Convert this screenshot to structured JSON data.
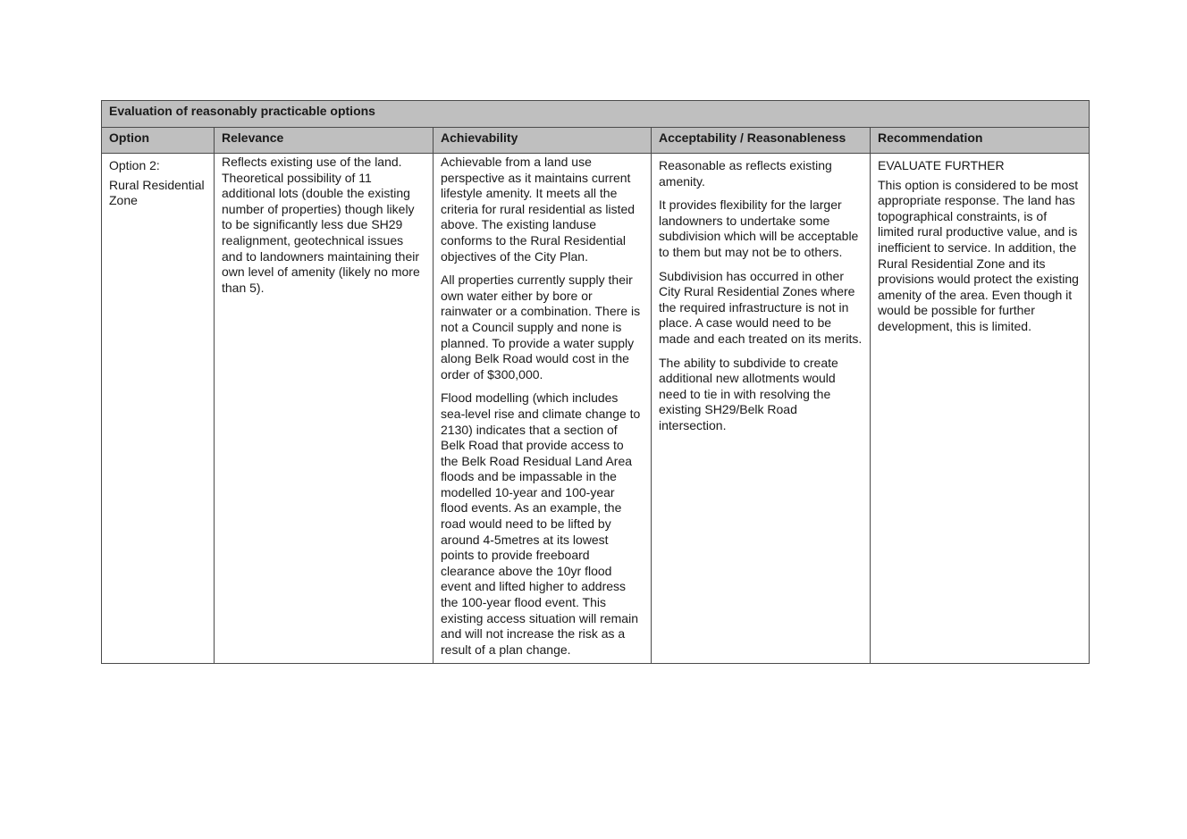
{
  "table": {
    "title": "Evaluation of reasonably practicable options",
    "headers": {
      "option": "Option",
      "relevance": "Relevance",
      "achievability": "Achievability",
      "acceptability": "Acceptability / Reasonableness",
      "recommendation": "Recommendation"
    },
    "row": {
      "option": [
        "Option 2:",
        "Rural Residential Zone"
      ],
      "relevance": [
        "Reflects existing use of the land. Theoretical possibility of 11 additional lots (double the existing number of properties) though likely to be significantly less due SH29 realignment, geotechnical issues and to landowners maintaining their own level of amenity (likely no more than 5)."
      ],
      "achievability": [
        "Achievable from a land use perspective as it maintains current lifestyle amenity. It meets all the criteria for rural residential as listed above. The existing landuse conforms to the Rural Residential objectives of the City Plan.",
        "All properties currently supply their own water either by bore or rainwater or a combination.  There is not a Council supply and none is planned. To provide a water supply along Belk Road would cost in the order of $300,000.",
        "Flood modelling (which includes sea-level rise and climate change to 2130) indicates that a section of Belk Road that provide access to the Belk Road Residual Land Area floods and be impassable in the modelled 10-year and 100-year flood events. As an example, the road would need to be lifted by around 4-5metres at its lowest points to provide freeboard clearance above the 10yr flood event and lifted higher to address the 100-year flood event. This existing access situation will remain and will not increase the risk as a result of a plan change."
      ],
      "acceptability": [
        "Reasonable as reflects existing amenity.",
        "It provides flexibility for the larger landowners to undertake some subdivision which will be acceptable to them but may not be to others.",
        "Subdivision has occurred in other City Rural Residential Zones where the required infrastructure is not in place. A case would need to be made and each treated on its merits.",
        "The ability to subdivide to create additional new allotments would need to tie in with resolving the existing SH29/Belk Road intersection."
      ],
      "recommendation": [
        "EVALUATE FURTHER",
        "This option is considered to be most appropriate response. The land has topographical constraints, is of limited rural productive value, and is inefficient to service. In addition, the Rural Residential Zone and its provisions would protect the existing amenity of the area. Even though it would be possible for further development, this is limited."
      ]
    }
  }
}
